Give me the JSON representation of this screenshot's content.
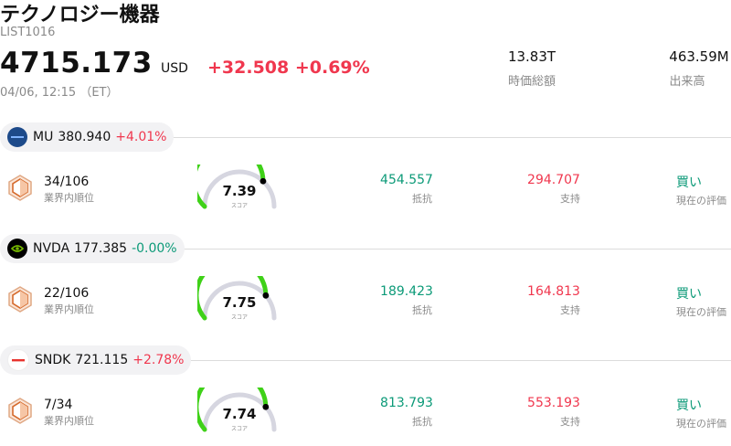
{
  "header": {
    "title": "テクノロジー機器",
    "code": "LIST1016",
    "price": "4715.173",
    "currency": "USD",
    "change": "+32.508 +0.69%",
    "timestamp": "04/06, 12:15 （ET）",
    "stats": [
      {
        "value": "13.83T",
        "label": "時価総額"
      },
      {
        "value": "463.59M",
        "label": "出来高"
      }
    ]
  },
  "colors": {
    "up": "#f0374e",
    "down": "#0c9a78",
    "gauge": "#3fd118",
    "gauge_track": "#d6d6e0"
  },
  "rows": [
    {
      "ticker": "MU",
      "price": "380.940",
      "change": "+4.01%",
      "change_dir": "up",
      "logo_icon": "micron-logo-icon",
      "logo_color": "#1d4a8a",
      "rank": "34/106",
      "rank_label": "業界内順位",
      "score": 7.39,
      "score_text": "7.39",
      "score_label": "スコア",
      "resistance": "454.557",
      "resistance_label": "抵抗",
      "support": "294.707",
      "support_label": "支持",
      "evaluation": "買い",
      "evaluation_label": "現在の評価"
    },
    {
      "ticker": "NVDA",
      "price": "177.385",
      "change": "-0.00%",
      "change_dir": "flat",
      "logo_icon": "nvidia-logo-icon",
      "logo_color": "#000000",
      "rank": "22/106",
      "rank_label": "業界内順位",
      "score": 7.75,
      "score_text": "7.75",
      "score_label": "スコア",
      "resistance": "189.423",
      "resistance_label": "抵抗",
      "support": "164.813",
      "support_label": "支持",
      "evaluation": "買い",
      "evaluation_label": "現在の評価"
    },
    {
      "ticker": "SNDK",
      "price": "721.115",
      "change": "+2.78%",
      "change_dir": "up",
      "logo_icon": "sandisk-logo-icon",
      "logo_color": "#ffffff",
      "rank": "7/34",
      "rank_label": "業界内順位",
      "score": 7.74,
      "score_text": "7.74",
      "score_label": "スコア",
      "resistance": "813.793",
      "resistance_label": "抵抗",
      "support": "553.193",
      "support_label": "支持",
      "evaluation": "買い",
      "evaluation_label": "現在の評価"
    }
  ]
}
